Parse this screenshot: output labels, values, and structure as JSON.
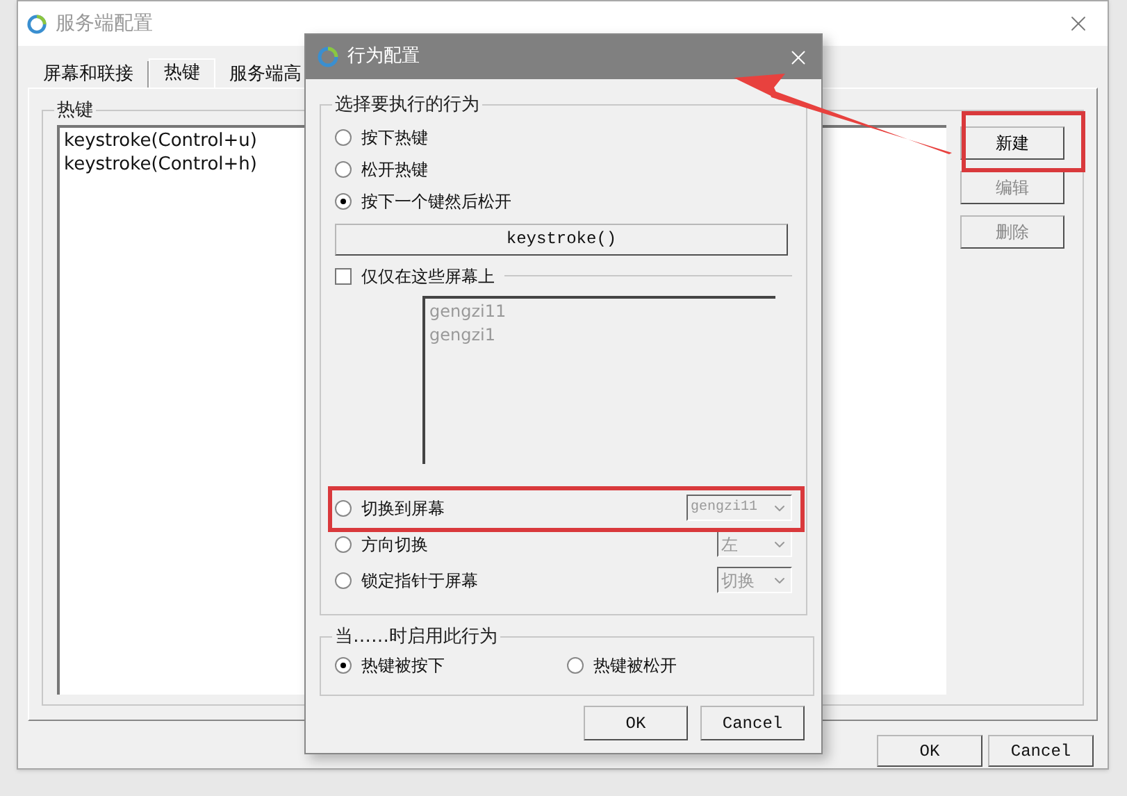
{
  "main_window": {
    "title": "服务端配置",
    "tabs": [
      {
        "label": "屏幕和联接",
        "selected": false
      },
      {
        "label": "热键",
        "selected": true
      },
      {
        "label": "服务端高",
        "selected": false
      }
    ],
    "hotkeys_group": {
      "title": "热键",
      "items": [
        "keystroke(Control+u)",
        "keystroke(Control+h)"
      ]
    },
    "side_buttons": [
      {
        "label": "新建",
        "disabled": false
      },
      {
        "label": "编辑",
        "disabled": true
      },
      {
        "label": "删除",
        "disabled": true
      }
    ],
    "buttons": [
      "OK",
      "Cancel"
    ]
  },
  "dialog": {
    "title": "行为配置",
    "action_group": {
      "title": "选择要执行的行为",
      "options": [
        {
          "label": "按下热键",
          "selected": false
        },
        {
          "label": "松开热键",
          "selected": false
        },
        {
          "label": "按下一个键然后松开",
          "selected": true
        }
      ],
      "keystroke_button": "keystroke()",
      "screens_only": {
        "label": "仅仅在这些屏幕上",
        "checked": false
      },
      "screens": {
        "disabled": true,
        "items": [
          "gengzi11",
          "gengzi1"
        ]
      },
      "switch_options": [
        {
          "label": "切换到屏幕",
          "selected": false,
          "dropdown": "gengzi11",
          "kind": "screen",
          "disabled": true
        },
        {
          "label": "方向切换",
          "selected": false,
          "dropdown": "左",
          "kind": "choice",
          "disabled": true
        },
        {
          "label": "锁定指针于屏幕",
          "selected": false,
          "dropdown": "切换",
          "kind": "choice",
          "disabled": true
        }
      ]
    },
    "trigger_group": {
      "title": "当……时启用此行为",
      "options": [
        {
          "label": "热键被按下",
          "selected": true
        },
        {
          "label": "热键被松开",
          "selected": false
        }
      ]
    },
    "buttons": [
      "OK",
      "Cancel"
    ]
  }
}
